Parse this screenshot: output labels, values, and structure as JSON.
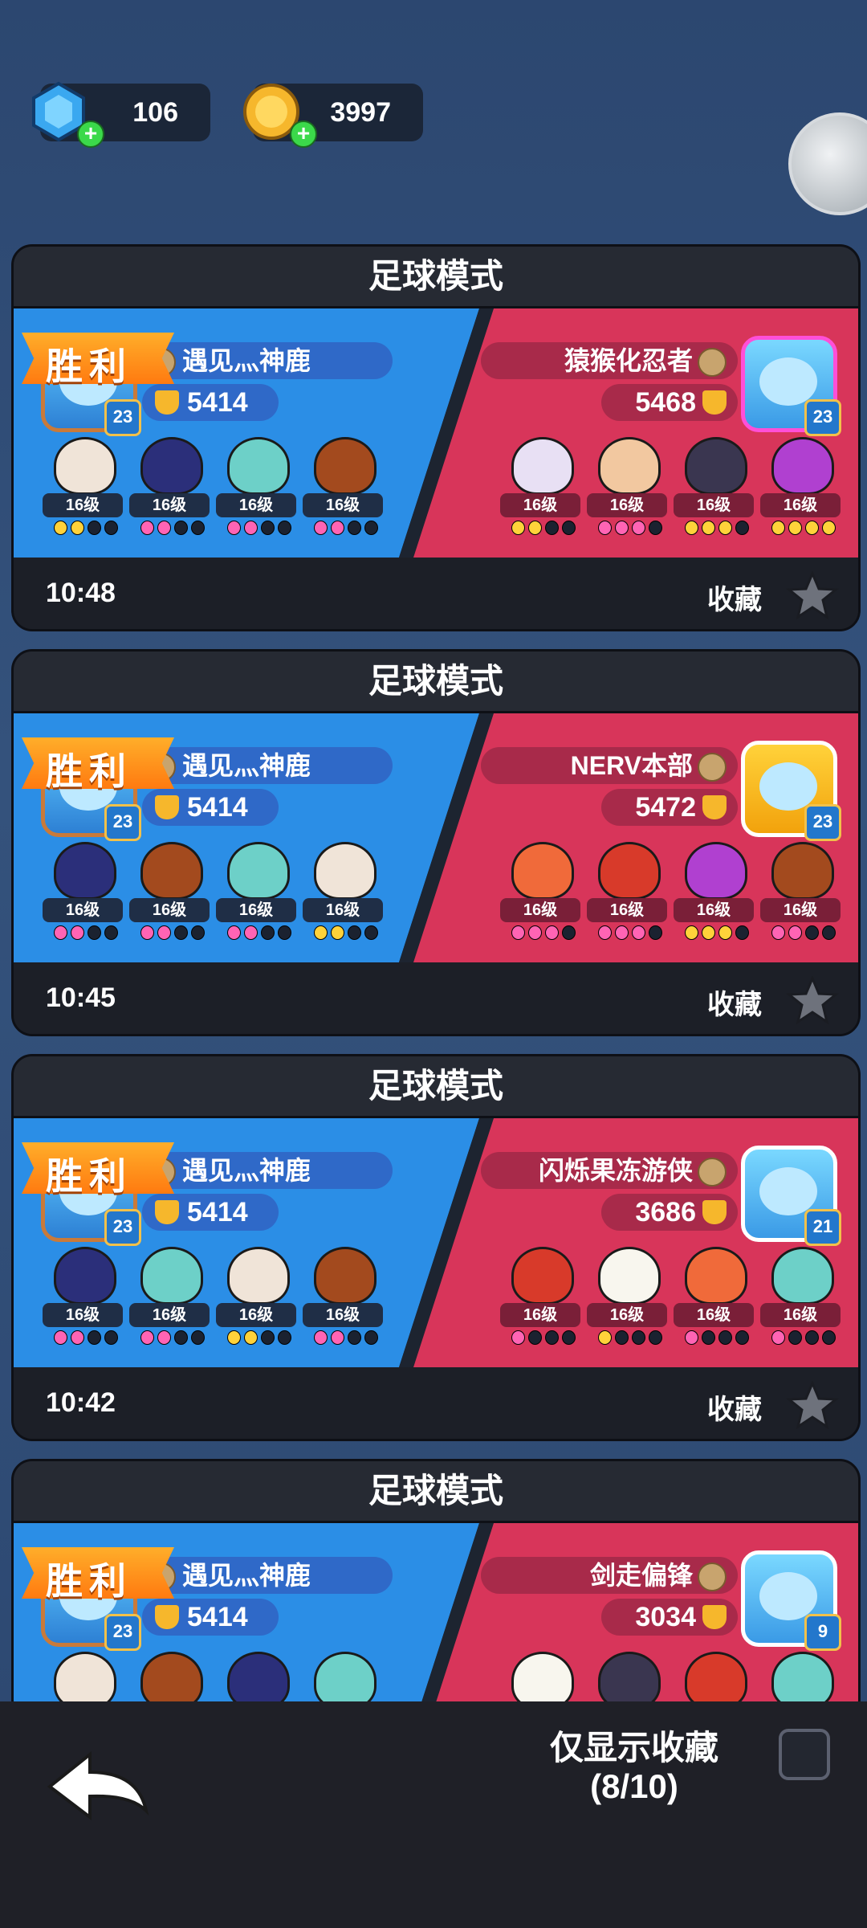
{
  "currencies": {
    "gems": "106",
    "coins": "3997"
  },
  "matches": [
    {
      "mode": "足球模式",
      "result": "胜利",
      "left": {
        "name": "遇见灬神鹿",
        "trophies": "5414",
        "level": "23",
        "brawlers": [
          {
            "level": "16级",
            "dots": [
              "y",
              "y",
              "n",
              "n"
            ],
            "color": "#f0e4d8"
          },
          {
            "level": "16级",
            "dots": [
              "p",
              "p",
              "n",
              "n"
            ],
            "color": "#2b2f7a"
          },
          {
            "level": "16级",
            "dots": [
              "p",
              "p",
              "n",
              "n"
            ],
            "color": "#6dd0c8"
          },
          {
            "level": "16级",
            "dots": [
              "p",
              "p",
              "n",
              "n"
            ],
            "color": "#a34a1e"
          }
        ]
      },
      "right": {
        "name": "猿猴化忍者",
        "trophies": "5468",
        "level": "23",
        "brawlers": [
          {
            "level": "16级",
            "dots": [
              "y",
              "y",
              "n",
              "n"
            ],
            "color": "#e8e0f4"
          },
          {
            "level": "16级",
            "dots": [
              "p",
              "p",
              "p",
              "n"
            ],
            "color": "#f2c8a0"
          },
          {
            "level": "16级",
            "dots": [
              "y",
              "y",
              "y",
              "n"
            ],
            "color": "#3a3650"
          },
          {
            "level": "16级",
            "dots": [
              "y",
              "y",
              "y",
              "y"
            ],
            "color": "#b040d0"
          }
        ]
      },
      "time": "10:48",
      "favorite_label": "收藏"
    },
    {
      "mode": "足球模式",
      "result": "胜利",
      "left": {
        "name": "遇见灬神鹿",
        "trophies": "5414",
        "level": "23",
        "brawlers": [
          {
            "level": "16级",
            "dots": [
              "p",
              "p",
              "n",
              "n"
            ],
            "color": "#2b2f7a"
          },
          {
            "level": "16级",
            "dots": [
              "p",
              "p",
              "n",
              "n"
            ],
            "color": "#a34a1e"
          },
          {
            "level": "16级",
            "dots": [
              "p",
              "p",
              "n",
              "n"
            ],
            "color": "#6dd0c8"
          },
          {
            "level": "16级",
            "dots": [
              "y",
              "y",
              "n",
              "n"
            ],
            "color": "#f0e4d8"
          }
        ]
      },
      "right": {
        "name": "NERV本部",
        "trophies": "5472",
        "level": "23",
        "brawlers": [
          {
            "level": "16级",
            "dots": [
              "p",
              "p",
              "p",
              "n"
            ],
            "color": "#f06a3a"
          },
          {
            "level": "16级",
            "dots": [
              "p",
              "p",
              "p",
              "n"
            ],
            "color": "#d83a2a"
          },
          {
            "level": "16级",
            "dots": [
              "y",
              "y",
              "y",
              "n"
            ],
            "color": "#b040d0"
          },
          {
            "level": "16级",
            "dots": [
              "p",
              "p",
              "n",
              "n"
            ],
            "color": "#a34a1e"
          }
        ]
      },
      "time": "10:45",
      "favorite_label": "收藏"
    },
    {
      "mode": "足球模式",
      "result": "胜利",
      "left": {
        "name": "遇见灬神鹿",
        "trophies": "5414",
        "level": "23",
        "brawlers": [
          {
            "level": "16级",
            "dots": [
              "p",
              "p",
              "n",
              "n"
            ],
            "color": "#2b2f7a"
          },
          {
            "level": "16级",
            "dots": [
              "p",
              "p",
              "n",
              "n"
            ],
            "color": "#6dd0c8"
          },
          {
            "level": "16级",
            "dots": [
              "y",
              "y",
              "n",
              "n"
            ],
            "color": "#f0e4d8"
          },
          {
            "level": "16级",
            "dots": [
              "p",
              "p",
              "n",
              "n"
            ],
            "color": "#a34a1e"
          }
        ]
      },
      "right": {
        "name": "闪烁果冻游侠",
        "trophies": "3686",
        "level": "21",
        "brawlers": [
          {
            "level": "16级",
            "dots": [
              "p",
              "n",
              "n",
              "n"
            ],
            "color": "#d83a2a"
          },
          {
            "level": "16级",
            "dots": [
              "y",
              "n",
              "n",
              "n"
            ],
            "color": "#f8f6ee"
          },
          {
            "level": "16级",
            "dots": [
              "p",
              "n",
              "n",
              "n"
            ],
            "color": "#f06a3a"
          },
          {
            "level": "16级",
            "dots": [
              "p",
              "n",
              "n",
              "n"
            ],
            "color": "#6dd0c8"
          }
        ]
      },
      "time": "10:42",
      "favorite_label": "收藏"
    },
    {
      "mode": "足球模式",
      "result": "胜利",
      "left": {
        "name": "遇见灬神鹿",
        "trophies": "5414",
        "level": "23",
        "brawlers": [
          {
            "level": "",
            "dots": [],
            "color": "#f0e4d8"
          },
          {
            "level": "",
            "dots": [],
            "color": "#a34a1e"
          },
          {
            "level": "",
            "dots": [],
            "color": "#2b2f7a"
          },
          {
            "level": "",
            "dots": [],
            "color": "#6dd0c8"
          }
        ]
      },
      "right": {
        "name": "剑走偏锋",
        "trophies": "3034",
        "level": "9",
        "brawlers": [
          {
            "level": "",
            "dots": [],
            "color": "#f8f6ee"
          },
          {
            "level": "",
            "dots": [],
            "color": "#3a3650"
          },
          {
            "level": "",
            "dots": [],
            "color": "#d83a2a"
          },
          {
            "level": "",
            "dots": [],
            "color": "#6dd0c8"
          }
        ]
      },
      "time": "",
      "favorite_label": ""
    }
  ],
  "bottom": {
    "show_fav_label": "仅显示收藏",
    "fav_count": "(8/10)"
  }
}
